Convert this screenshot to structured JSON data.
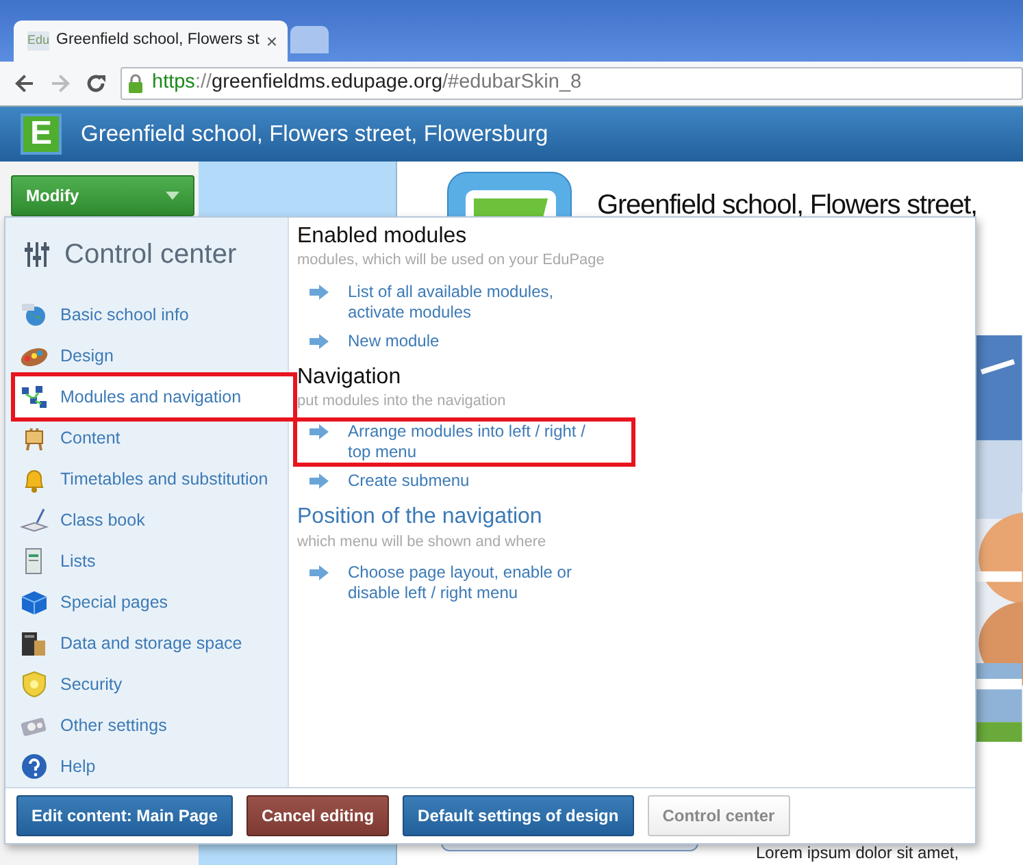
{
  "browser": {
    "tabs": [
      {
        "favicon": "Edu",
        "title": "Greenfield school, Flowers st",
        "close": "×",
        "selected": true
      },
      {
        "selected": false
      }
    ],
    "url": {
      "scheme": "https",
      "separator": "://",
      "host": "greenfieldms.edupage.org",
      "path": "/#edubarSkin_8"
    }
  },
  "site": {
    "logo_letter": "E",
    "title": "Greenfield school, Flowers street, Flowersburg",
    "modify_button": "Modify",
    "heading": "Greenfield school, Flowers street,",
    "lorem": "Lorem ipsum dolor sit amet,"
  },
  "control_center": {
    "title": "Control center",
    "sidebar": [
      {
        "label": "Basic school info",
        "selected": false,
        "highlighted": false
      },
      {
        "label": "Design",
        "selected": false,
        "highlighted": false
      },
      {
        "label": "Modules and navigation",
        "selected": true,
        "highlighted": true
      },
      {
        "label": "Content",
        "selected": false,
        "highlighted": false
      },
      {
        "label": "Timetables and substitution",
        "selected": false,
        "highlighted": false
      },
      {
        "label": "Class book",
        "selected": false,
        "highlighted": false
      },
      {
        "label": "Lists",
        "selected": false,
        "highlighted": false
      },
      {
        "label": "Special pages",
        "selected": false,
        "highlighted": false
      },
      {
        "label": "Data and storage space",
        "selected": false,
        "highlighted": false
      },
      {
        "label": "Security",
        "selected": false,
        "highlighted": false
      },
      {
        "label": "Other settings",
        "selected": false,
        "highlighted": false
      },
      {
        "label": "Help",
        "selected": false,
        "highlighted": false
      }
    ],
    "sections": [
      {
        "title": "Enabled modules",
        "kind": "heading",
        "subtitle": "modules, which will be used on your EduPage",
        "links": [
          {
            "label": "List of all available modules, activate modules",
            "highlighted": false
          },
          {
            "label": "New module",
            "highlighted": false
          }
        ]
      },
      {
        "title": "Navigation",
        "kind": "heading",
        "subtitle": "put modules into the navigation",
        "links": [
          {
            "label": "Arrange modules into left / right / top menu",
            "highlighted": true
          },
          {
            "label": "Create submenu",
            "highlighted": false
          }
        ]
      },
      {
        "title": "Position of the navigation",
        "kind": "link",
        "subtitle": "which menu will be shown and where",
        "links": [
          {
            "label": "Choose page layout, enable or disable left / right menu",
            "highlighted": false
          }
        ]
      }
    ],
    "footer_buttons": [
      {
        "label": "Edit content: Main Page",
        "kind": "primary"
      },
      {
        "label": "Cancel editing",
        "kind": "danger"
      },
      {
        "label": "Default settings of design",
        "kind": "primary"
      },
      {
        "label": "Control center",
        "kind": "default"
      }
    ]
  }
}
